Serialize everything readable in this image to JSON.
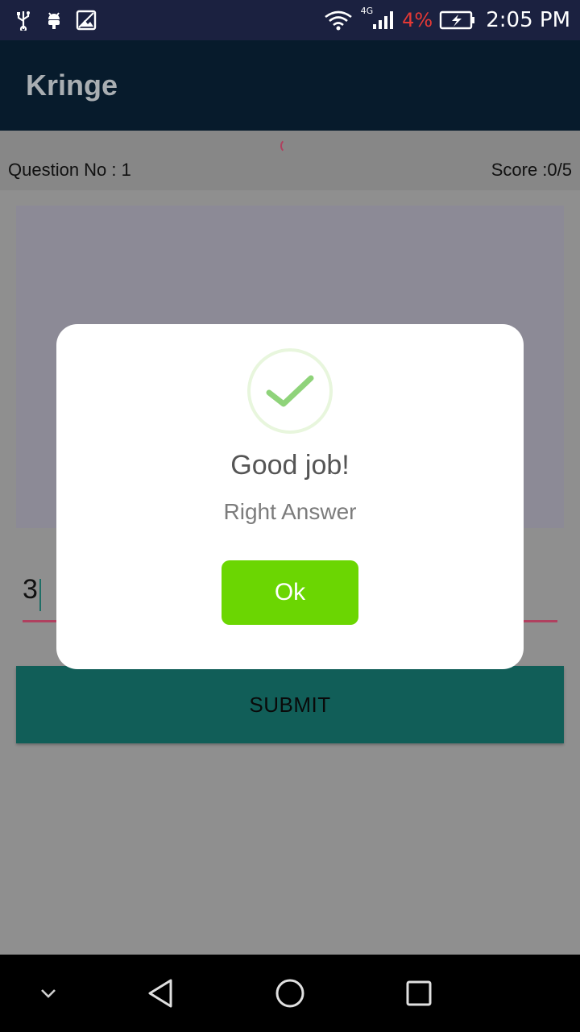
{
  "status_bar": {
    "icons": [
      "usb-icon",
      "android-debug-icon",
      "image-icon",
      "wifi-icon",
      "cellular-signal-icon",
      "battery-charging-icon"
    ],
    "network_type": "4G",
    "battery_percent": "4%",
    "time": "2:05 PM",
    "colors": {
      "background": "#1b2140",
      "battery_low": "#e53935"
    }
  },
  "app_bar": {
    "title": "Kringe"
  },
  "quiz": {
    "question_label": "Question No : 1",
    "score_label": "Score :0/5",
    "answer_value": "3",
    "submit_label": "SUBMIT"
  },
  "dialog": {
    "icon": "checkmark-icon",
    "title": "Good job!",
    "message": "Right Answer",
    "ok_label": "Ok",
    "colors": {
      "ok_button": "#6bd602",
      "check": "#8fd37a"
    }
  },
  "nav_bar": {
    "buttons": [
      "chevron-down-icon",
      "back-icon",
      "home-icon",
      "recents-icon"
    ]
  }
}
